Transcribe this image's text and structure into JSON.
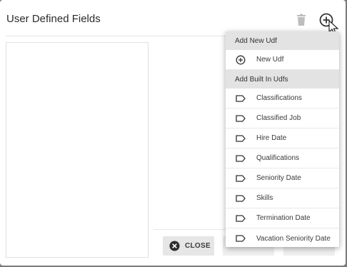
{
  "dialog": {
    "title": "User Defined Fields",
    "close_label": "CLOSE"
  },
  "menu": {
    "section_new_title": "Add New Udf",
    "new_udf_label": "New Udf",
    "section_builtin_title": "Add Built In Udfs",
    "builtin_items": [
      {
        "label": "Classifications",
        "icon": "label-icon"
      },
      {
        "label": "Classified Job",
        "icon": "label-icon"
      },
      {
        "label": "Hire Date",
        "icon": "label-icon"
      },
      {
        "label": "Qualifications",
        "icon": "label-icon"
      },
      {
        "label": "Seniority Date",
        "icon": "label-icon"
      },
      {
        "label": "Skills",
        "icon": "label-icon"
      },
      {
        "label": "Termination Date",
        "icon": "label-icon"
      },
      {
        "label": "Vacation Seniority Date",
        "icon": "label-icon"
      }
    ]
  },
  "colors": {
    "header_bg": "#e3e3e3",
    "icon_gray": "#bdbdbd",
    "text": "#3a3a3a"
  }
}
